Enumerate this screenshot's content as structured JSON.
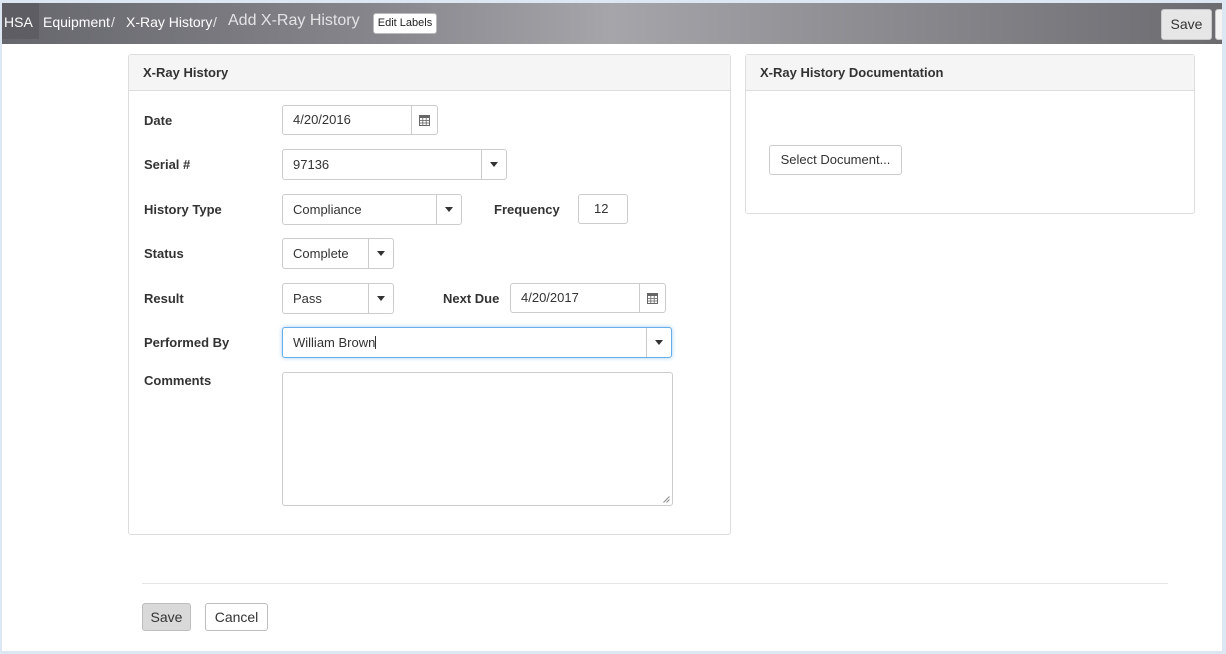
{
  "breadcrumb": {
    "home": "HSA",
    "items": [
      "Equipment",
      "X-Ray History"
    ],
    "separator": "/",
    "current": "Add X-Ray History"
  },
  "toolbar": {
    "edit_labels": "Edit Labels",
    "save_label": "Save"
  },
  "form_panel": {
    "title": "X-Ray History",
    "date": {
      "label": "Date",
      "value": "4/20/2016",
      "icon": "calendar-icon"
    },
    "serial": {
      "label": "Serial #",
      "value": "97136"
    },
    "history_type": {
      "label": "History Type",
      "value": "Compliance"
    },
    "frequency": {
      "label": "Frequency",
      "value": "12"
    },
    "status": {
      "label": "Status",
      "value": "Complete"
    },
    "result": {
      "label": "Result",
      "value": "Pass"
    },
    "next_due": {
      "label": "Next Due",
      "value": "4/20/2017",
      "icon": "calendar-icon"
    },
    "performed_by": {
      "label": "Performed By",
      "value": "William Brown"
    },
    "comments": {
      "label": "Comments",
      "value": ""
    }
  },
  "doc_panel": {
    "title": "X-Ray History Documentation",
    "select_label": "Select Document..."
  },
  "footer": {
    "save_label": "Save",
    "cancel_label": "Cancel"
  },
  "colors": {
    "topbar_left": "#66666d",
    "topbar_mid": "#a5a5aa",
    "focus_border": "#66afe9"
  }
}
